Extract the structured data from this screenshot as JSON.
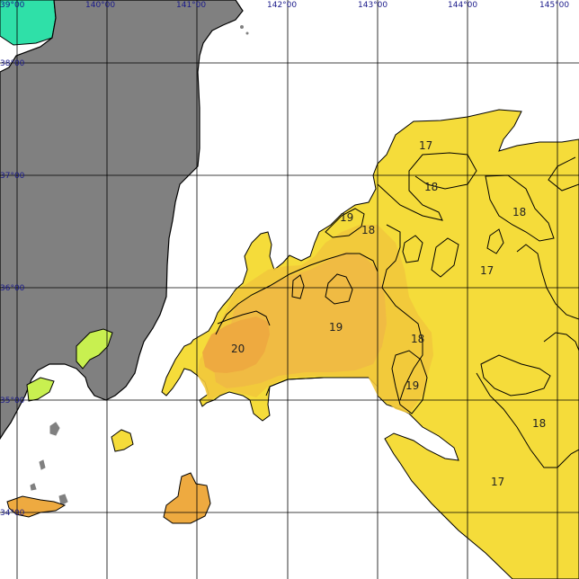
{
  "map": {
    "lon_ticks": [
      {
        "id": "lon-139",
        "label": "39°00"
      },
      {
        "id": "lon-140",
        "label": "140°00"
      },
      {
        "id": "lon-141",
        "label": "141°00"
      },
      {
        "id": "lon-142",
        "label": "142°00"
      },
      {
        "id": "lon-143",
        "label": "143°00"
      },
      {
        "id": "lon-144",
        "label": "144°00"
      },
      {
        "id": "lon-145",
        "label": "145°00"
      }
    ],
    "lat_ticks": [
      {
        "id": "lat-38",
        "label": "38°00"
      },
      {
        "id": "lat-37",
        "label": "37°00"
      },
      {
        "id": "lat-36",
        "label": "36°00"
      },
      {
        "id": "lat-35",
        "label": "35°00"
      },
      {
        "id": "lat-34",
        "label": "34°00"
      }
    ],
    "contour_labels": [
      {
        "id": "iso-17-a",
        "text": "17"
      },
      {
        "id": "iso-18-a",
        "text": "18"
      },
      {
        "id": "iso-18-b",
        "text": "18"
      },
      {
        "id": "iso-19-a",
        "text": "19"
      },
      {
        "id": "iso-18-c",
        "text": "18"
      },
      {
        "id": "iso-17-b",
        "text": "17"
      },
      {
        "id": "iso-19-b",
        "text": "19"
      },
      {
        "id": "iso-20",
        "text": "20"
      },
      {
        "id": "iso-18-d",
        "text": "18"
      },
      {
        "id": "iso-19-c",
        "text": "19"
      },
      {
        "id": "iso-18-e",
        "text": "18"
      },
      {
        "id": "iso-17-c",
        "text": "17"
      }
    ],
    "colors": {
      "land": "#808080",
      "sea_background": "#ffffff",
      "grid": "#000000",
      "temp_17": "#f5dc3a",
      "temp_18": "#f2c83c",
      "temp_19": "#f0b845",
      "temp_20": "#eeaa40",
      "cold_13": "#2fe0a8",
      "cold_15": "#c8f050"
    }
  }
}
